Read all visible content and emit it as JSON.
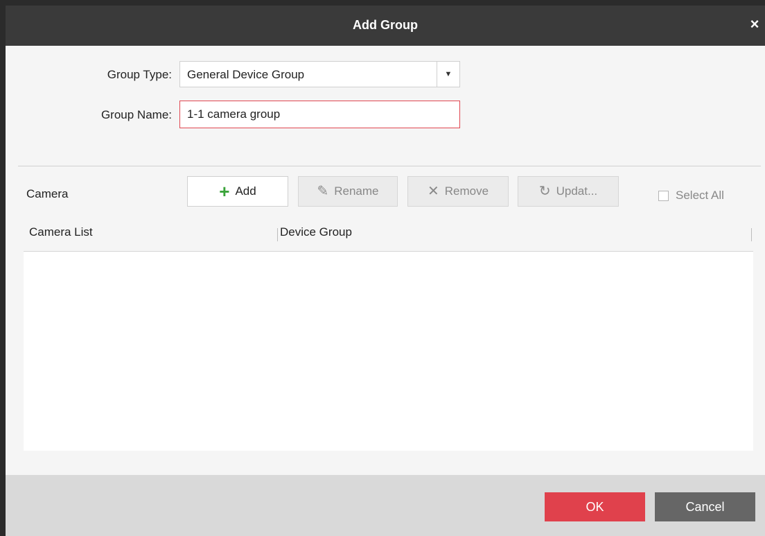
{
  "dialog": {
    "title": "Add Group",
    "close_glyph": "×"
  },
  "form": {
    "group_type_label": "Group Type:",
    "group_type_value": "General Device Group",
    "group_name_label": "Group Name:",
    "group_name_value": "1-1 camera group"
  },
  "camera_section": {
    "label": "Camera",
    "toolbar": {
      "add": {
        "label": "Add",
        "icon": "plus-icon",
        "glyph": "+"
      },
      "rename": {
        "label": "Rename",
        "icon": "pencil-icon",
        "glyph": "✎"
      },
      "remove": {
        "label": "Remove",
        "icon": "x-icon",
        "glyph": "✕"
      },
      "update": {
        "label": "Updat...",
        "icon": "refresh-icon",
        "glyph": "↻"
      }
    },
    "select_all_label": "Select All",
    "table": {
      "columns": [
        "Camera List",
        "Device Group"
      ],
      "rows": []
    }
  },
  "footer": {
    "ok_label": "OK",
    "cancel_label": "Cancel"
  },
  "colors": {
    "titlebar": "#3a3a3a",
    "accent_red": "#e0414c",
    "cancel_gray": "#666666",
    "add_green": "#3aa33a"
  }
}
